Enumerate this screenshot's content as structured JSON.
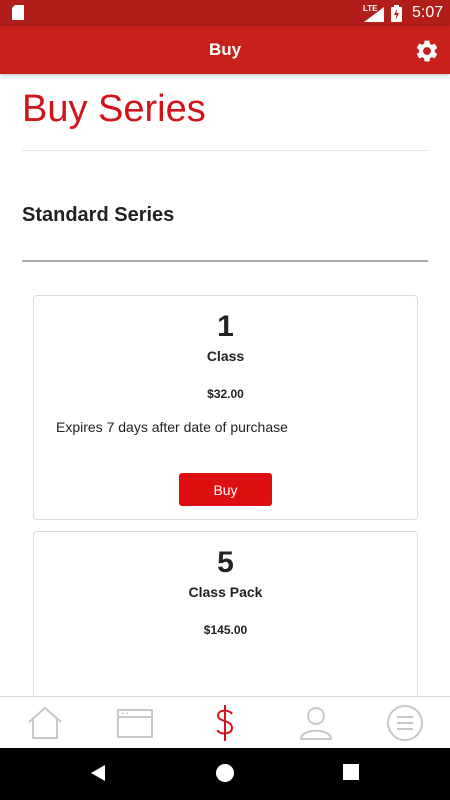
{
  "status_bar": {
    "network_label": "LTE",
    "time": "5:07",
    "icons": [
      "sd-card-icon",
      "signal-icon",
      "battery-charging-icon"
    ]
  },
  "app_bar": {
    "title": "Buy",
    "settings_icon": "gear-icon",
    "color": "#c8211b"
  },
  "page": {
    "title": "Buy Series",
    "section_title": "Standard Series",
    "accent_color": "#d0141a"
  },
  "series": [
    {
      "quantity": "1",
      "unit": "Class",
      "price": "$32.00",
      "expires": "Expires 7 days after date of purchase",
      "button_label": "Buy"
    },
    {
      "quantity": "5",
      "unit": "Class Pack",
      "price": "$145.00"
    }
  ],
  "tab_bar": {
    "tabs": [
      {
        "icon": "home-icon",
        "active": false
      },
      {
        "icon": "calendar-window-icon",
        "active": false
      },
      {
        "icon": "dollar-icon",
        "active": true
      },
      {
        "icon": "person-icon",
        "active": false
      },
      {
        "icon": "menu-icon",
        "active": false
      }
    ],
    "active_color": "#d0141a",
    "inactive_color": "#c8c8c8"
  },
  "nav_bar": {
    "buttons": [
      "back-icon",
      "home-circle-icon",
      "recents-icon"
    ]
  }
}
